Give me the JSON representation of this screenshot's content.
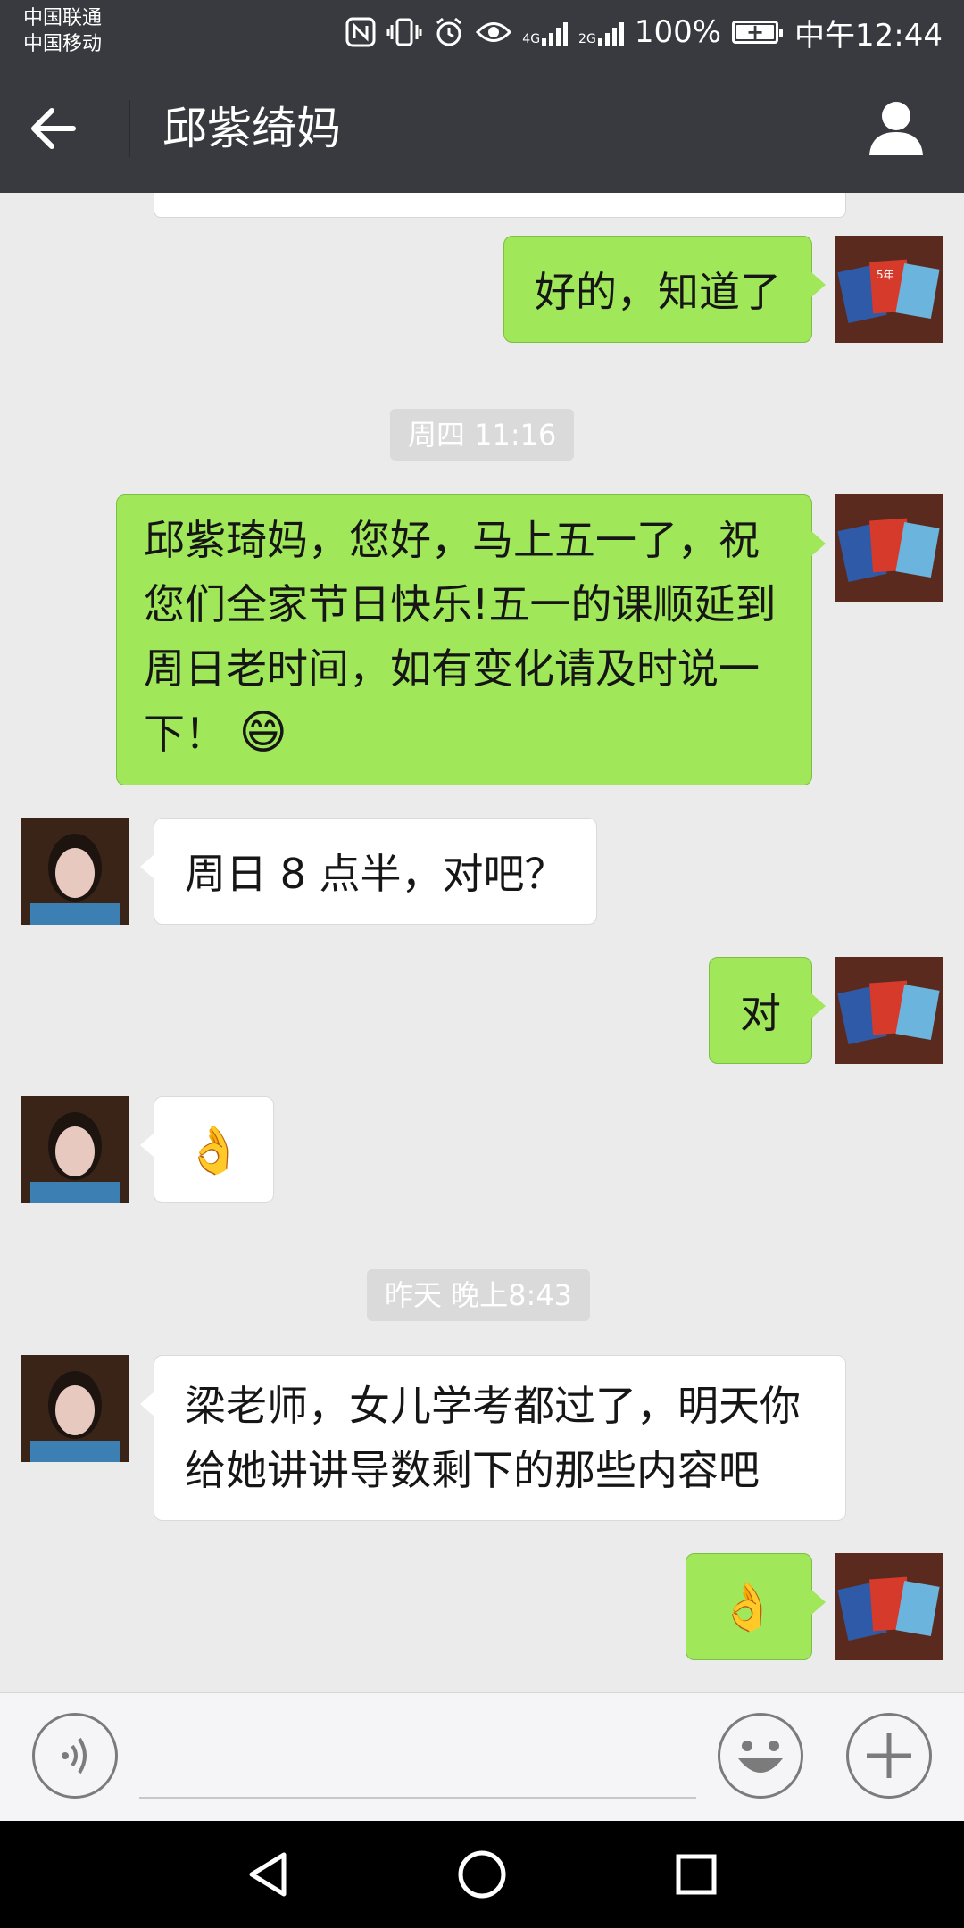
{
  "status_bar": {
    "carrier1": "中国联通",
    "carrier2": "中国移动",
    "net1": "4G",
    "net2": "2G",
    "battery": "100%",
    "time": "中午12:44",
    "icons": [
      "nfc-icon",
      "vibrate-icon",
      "alarm-icon",
      "eye-icon",
      "signal-icon",
      "battery-icon"
    ]
  },
  "header": {
    "title": "邱紫绮妈",
    "back_icon": "arrow-left-icon",
    "profile_icon": "person-icon"
  },
  "messages": [
    {
      "sender": "self",
      "text": "好的，知道了"
    },
    {
      "type": "time",
      "text": "周四 11:16"
    },
    {
      "sender": "self",
      "text_lines": [
        "邱紫琦妈，您好，马上五一了，祝",
        "您们全家节日快乐!五一的课顺延到",
        "周日老时间，如有变化请及时说一"
      ],
      "last_line": "下！",
      "emoji": "😄"
    },
    {
      "sender": "other",
      "text": "周日 8 点半，对吧？"
    },
    {
      "sender": "self",
      "text": "对"
    },
    {
      "sender": "other",
      "emoji": "👌"
    },
    {
      "type": "time",
      "text": "昨天 晚上8:43"
    },
    {
      "sender": "other",
      "text_lines": [
        "梁老师，女儿学考都过了，明天你",
        "给她讲讲导数剩下的那些内容吧"
      ]
    },
    {
      "sender": "self",
      "emoji": "👌"
    }
  ],
  "input_bar": {
    "voice_icon": "voice-icon",
    "emoji_icon": "smiley-icon",
    "add_icon": "plus-icon"
  },
  "nav_bar": {
    "icons": [
      "back-triangle-icon",
      "home-circle-icon",
      "recents-square-icon"
    ]
  },
  "colors": {
    "header": "#393a3f",
    "chat_bg": "#ebebeb",
    "self_bubble": "#a0e75a",
    "other_bubble": "#ffffff"
  }
}
